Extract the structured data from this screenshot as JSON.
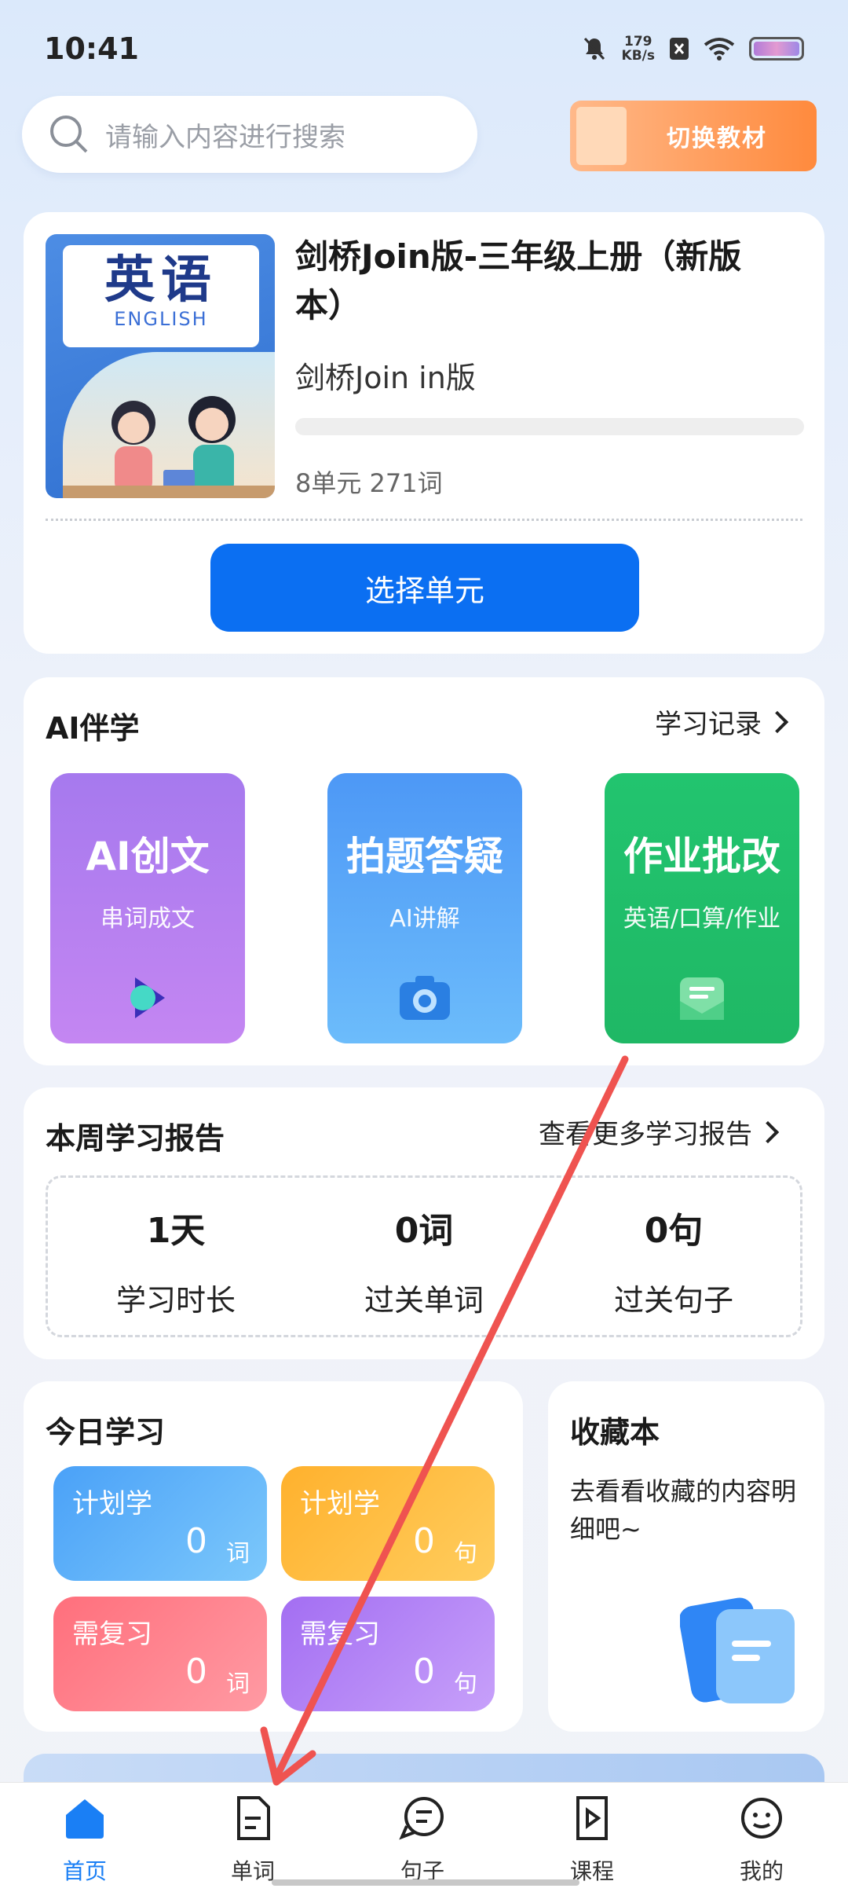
{
  "status": {
    "time": "10:41",
    "speed_value": "179",
    "speed_unit": "KB/s"
  },
  "search": {
    "placeholder": "请输入内容进行搜索"
  },
  "switch_book": {
    "label": "切换教材"
  },
  "book": {
    "cover_cn": "英语",
    "cover_en": "ENGLISH",
    "title": "剑桥Join版-三年级上册（新版本）",
    "series": "剑桥Join in版",
    "counts": "8单元 271词",
    "progress": 0,
    "select_button": "选择单元"
  },
  "ai": {
    "title": "AI伴学",
    "link": "学习记录",
    "cards": [
      {
        "title": "AI创文",
        "sub": "串词成文"
      },
      {
        "title": "拍题答疑",
        "sub": "AI讲解"
      },
      {
        "title": "作业批改",
        "sub": "英语/口算/作业"
      }
    ]
  },
  "report": {
    "title": "本周学习报告",
    "link": "查看更多学习报告",
    "stats": [
      {
        "value": "1天",
        "label": "学习时长"
      },
      {
        "value": "0词",
        "label": "过关单词"
      },
      {
        "value": "0句",
        "label": "过关句子"
      }
    ]
  },
  "today": {
    "title": "今日学习",
    "tiles": [
      {
        "label": "计划学",
        "num": "0",
        "unit": "词"
      },
      {
        "label": "计划学",
        "num": "0",
        "unit": "句"
      },
      {
        "label": "需复习",
        "num": "0",
        "unit": "词"
      },
      {
        "label": "需复习",
        "num": "0",
        "unit": "句"
      }
    ]
  },
  "favorites": {
    "title": "收藏本",
    "desc": "去看看收藏的内容明细吧~"
  },
  "tabs": [
    {
      "label": "首页"
    },
    {
      "label": "单词"
    },
    {
      "label": "句子"
    },
    {
      "label": "课程"
    },
    {
      "label": "我的"
    }
  ],
  "colors": {
    "accent": "#0b6ff2",
    "annotation_arrow": "#ef5350"
  }
}
